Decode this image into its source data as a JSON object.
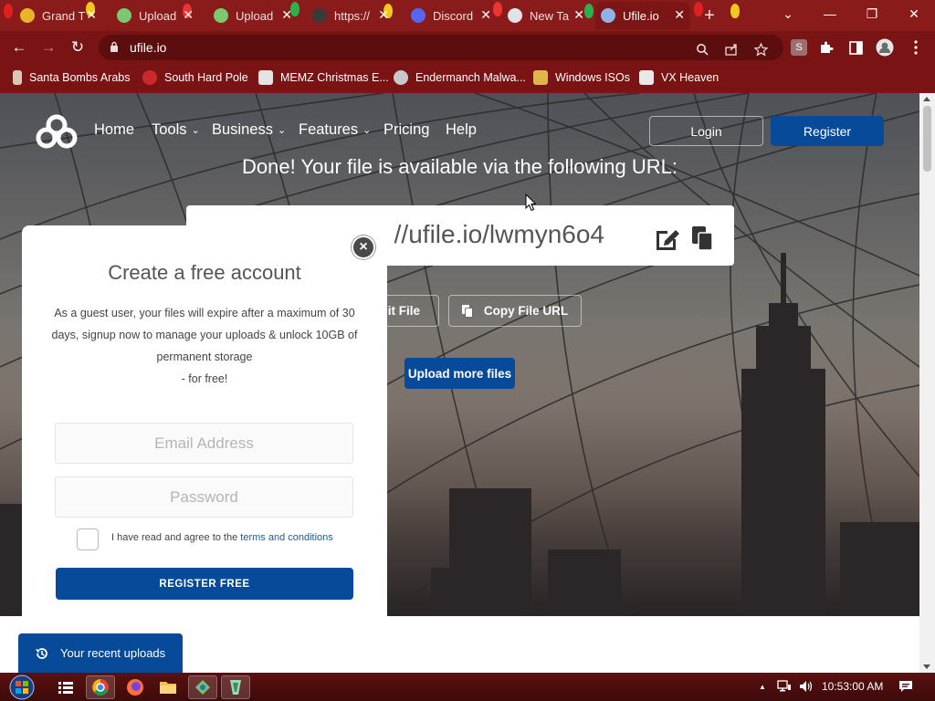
{
  "browser": {
    "tabs": [
      {
        "title": "Grand T",
        "favicon_color": "#e8b42a"
      },
      {
        "title": "Upload",
        "favicon_color": "#7bc96f"
      },
      {
        "title": "Upload",
        "favicon_color": "#7bc96f"
      },
      {
        "title": "https://",
        "favicon_color": "#3a3a3a"
      },
      {
        "title": "Discord",
        "favicon_color": "#5865f2"
      },
      {
        "title": "New Ta",
        "favicon_color": "#dfe3e8"
      },
      {
        "title": "Ufile.io",
        "favicon_color": "#8db4e8"
      }
    ],
    "close_glyph": "✕",
    "new_tab_glyph": "+",
    "window_controls": {
      "tab_search": "⌄",
      "minimize": "—",
      "restore": "❐",
      "close": "✕"
    },
    "nav": {
      "back": "←",
      "forward": "→",
      "reload": "↻"
    },
    "address": "ufile.io",
    "omnibox_icons": [
      "search-icon",
      "share-icon",
      "star-icon"
    ],
    "extension_letter": "S",
    "bookmarks": [
      {
        "label": "Santa Bombs Arabs",
        "icon_color": "#d9c9b4"
      },
      {
        "label": "South Hard Pole",
        "icon_color": "#cc2a2a"
      },
      {
        "label": "MEMZ Christmas E...",
        "icon_color": "#e4e4e4"
      },
      {
        "label": "Endermanch Malwa...",
        "icon_color": "#c8c8c8"
      },
      {
        "label": "Windows ISOs",
        "icon_color": "#e0b64a"
      },
      {
        "label": "VX Heaven",
        "icon_color": "#e8e8e8"
      }
    ]
  },
  "site": {
    "nav": [
      {
        "label": "Home",
        "dropdown": false
      },
      {
        "label": "Tools",
        "dropdown": true
      },
      {
        "label": "Business",
        "dropdown": true
      },
      {
        "label": "Features",
        "dropdown": true
      },
      {
        "label": "Pricing",
        "dropdown": false
      },
      {
        "label": "Help",
        "dropdown": false
      }
    ],
    "dropdown_glyph": "⌄",
    "login": "Login",
    "register": "Register",
    "done_prefix": "Done! Your file is available via ",
    "done_bold": "the following URL",
    "done_suffix": ":",
    "file_url_visible": "//ufile.io/lwmyn6o4",
    "edit_file": "Edit File",
    "copy_file_url": "Copy File URL",
    "upload_more": "Upload more files",
    "accent": "#074a9a"
  },
  "modal": {
    "title": "Create a free account",
    "description": "As a guest user, your files will expire after a maximum of 30 days, signup now to manage your uploads & unlock 10GB of permanent storage",
    "description_tail": "- for free!",
    "close": "×",
    "email_placeholder": "Email Address",
    "password_placeholder": "Password",
    "agree_text": "I have read and agree to the ",
    "terms_link": "terms and conditions",
    "register_free": "REGISTER FREE"
  },
  "recent_uploads": "Your recent uploads",
  "taskbar": {
    "time": "10:53:00 AM",
    "tray_expand": "▲"
  }
}
